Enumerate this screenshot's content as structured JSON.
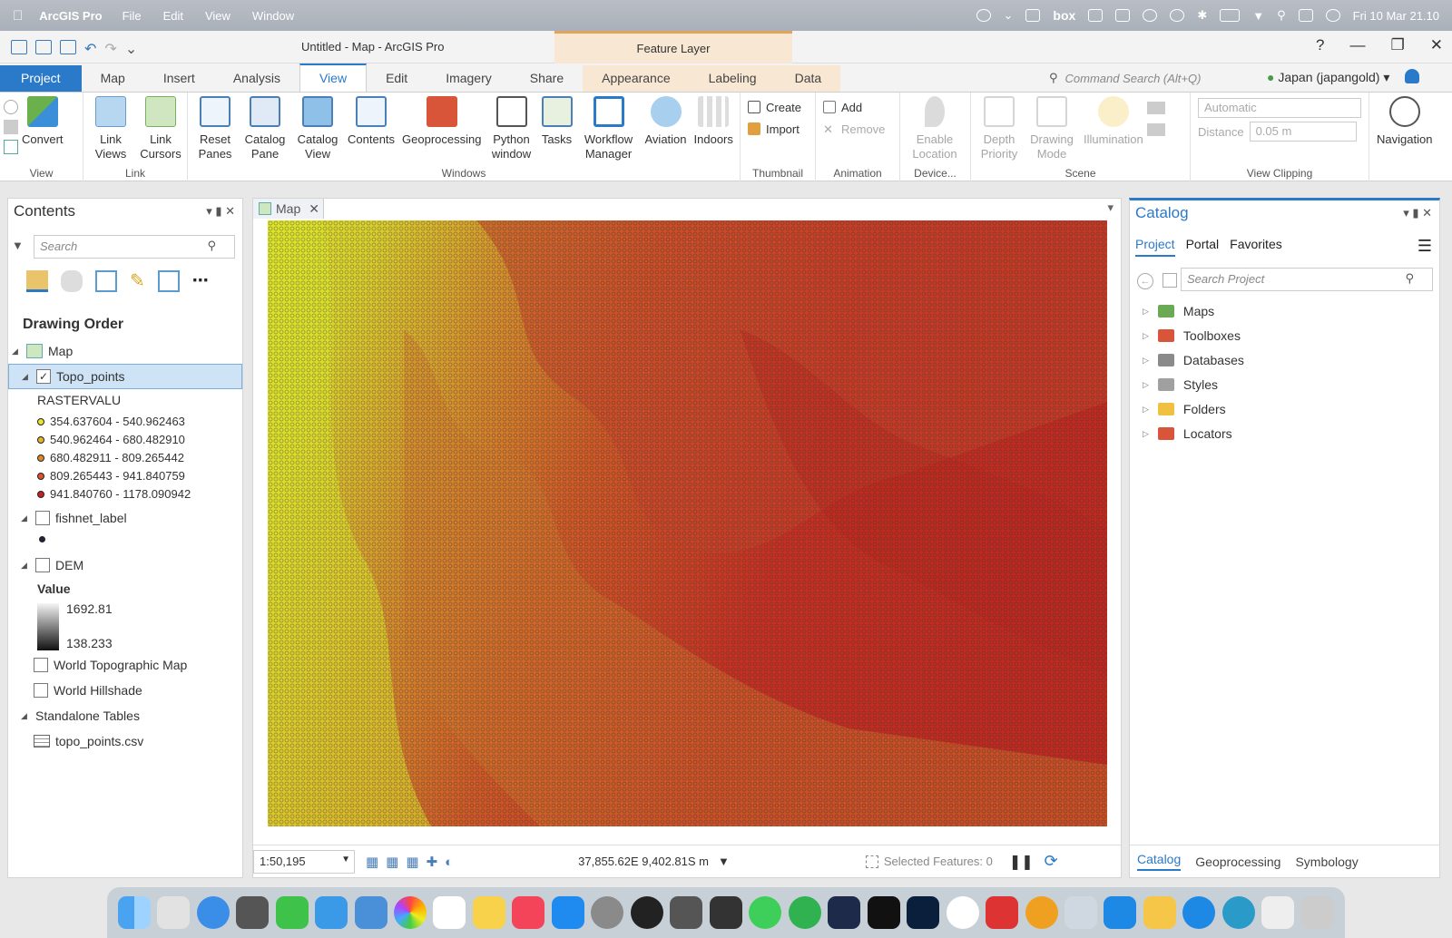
{
  "menubar": {
    "app": "ArcGIS Pro",
    "items": [
      "File",
      "Edit",
      "View",
      "Window"
    ],
    "box": "box",
    "clock": "Fri 10 Mar  21.10"
  },
  "window": {
    "title": "Untitled - Map - ArcGIS Pro",
    "context_tab": "Feature Layer",
    "help": "?"
  },
  "tabs": [
    "Project",
    "Map",
    "Insert",
    "Analysis",
    "View",
    "Edit",
    "Imagery",
    "Share",
    "Appearance",
    "Labeling",
    "Data"
  ],
  "command_search": {
    "placeholder": "Command Search (Alt+Q)"
  },
  "account": "Japan (japangold)",
  "ribbon": {
    "view_group": {
      "label": "View",
      "convert": "Convert"
    },
    "link_group": {
      "label": "Link",
      "link_views": "Link Views",
      "link_cursors": "Link Cursors"
    },
    "windows_group": {
      "label": "Windows",
      "reset_panes": "Reset Panes",
      "catalog_pane": "Catalog Pane",
      "catalog_view": "Catalog View",
      "contents": "Contents",
      "geoprocessing": "Geoprocessing",
      "python_window": "Python window",
      "tasks": "Tasks",
      "workflow_manager": "Workflow Manager",
      "aviation": "Aviation",
      "indoors": "Indoors"
    },
    "thumbnail_group": {
      "label": "Thumbnail",
      "create": "Create",
      "import": "Import"
    },
    "animation_group": {
      "label": "Animation",
      "add": "Add",
      "remove": "Remove"
    },
    "device_group": {
      "label": "Device...",
      "enable_location": "Enable Location"
    },
    "scene_group": {
      "label": "Scene",
      "depth_priority": "Depth Priority",
      "drawing_mode": "Drawing Mode",
      "illumination": "Illumination"
    },
    "clipping_group": {
      "label": "View Clipping",
      "mode": "Automatic",
      "distance_label": "Distance",
      "distance_value": "0.05  m"
    },
    "navigation": "Navigation"
  },
  "contents": {
    "title": "Contents",
    "search_placeholder": "Search",
    "drawing_order": "Drawing Order",
    "map": "Map",
    "topo_points": "Topo_points",
    "rastervalu": "RASTERVALU",
    "classes": [
      {
        "label": "354.637604 - 540.962463",
        "color": "#e6e62e"
      },
      {
        "label": "540.962464 - 680.482910",
        "color": "#e3b52c"
      },
      {
        "label": "680.482911 - 809.265442",
        "color": "#e0862a"
      },
      {
        "label": "809.265443 - 941.840759",
        "color": "#d85628"
      },
      {
        "label": "941.840760 - 1178.090942",
        "color": "#c52222"
      }
    ],
    "fishnet_label": "fishnet_label",
    "dem": "DEM",
    "value": "Value",
    "dem_high": "1692.81",
    "dem_low": "138.233",
    "world_topo": "World Topographic Map",
    "world_hillshade": "World Hillshade",
    "standalone_tables": "Standalone Tables",
    "topo_csv": "topo_points.csv"
  },
  "map": {
    "tab": "Map",
    "scale": "1:50,195",
    "coords": "37,855.62E 9,402.81S m",
    "selected": "Selected Features: 0"
  },
  "catalog": {
    "title": "Catalog",
    "subtabs": [
      "Project",
      "Portal",
      "Favorites"
    ],
    "search_placeholder": "Search Project",
    "items": [
      "Maps",
      "Toolboxes",
      "Databases",
      "Styles",
      "Folders",
      "Locators"
    ],
    "bottom_tabs": [
      "Catalog",
      "Geoprocessing",
      "Symbology"
    ]
  },
  "colors": {
    "accent": "#2b79c9",
    "low": "#d8e32a",
    "mid": "#d9702a",
    "high": "#c02020"
  }
}
